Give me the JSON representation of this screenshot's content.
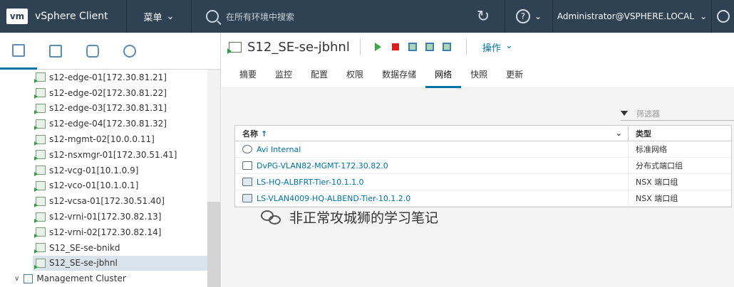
{
  "topbar": {
    "logo": "vm",
    "app_title": "vSphere Client",
    "menu_label": "菜单",
    "search_placeholder": "在所有环境中搜索",
    "user": "Administrator@VSPHERE.LOCAL"
  },
  "left_tabs": [
    {
      "icon": "hosts-clusters-icon"
    },
    {
      "icon": "vms-templates-icon"
    },
    {
      "icon": "storage-icon"
    },
    {
      "icon": "network-icon"
    }
  ],
  "tree": [
    {
      "label": "s12-edge-01[172.30.81.21]"
    },
    {
      "label": "s12-edge-02[172.30.81.22]"
    },
    {
      "label": "s12-edge-03[172.30.81.31]"
    },
    {
      "label": "s12-edge-04[172.30.81.32]"
    },
    {
      "label": "s12-mgmt-02[10.0.0.11]"
    },
    {
      "label": "s12-nsxmgr-01[172.30.51.41]"
    },
    {
      "label": "s12-vcg-01[10.1.0.9]"
    },
    {
      "label": "s12-vco-01[10.1.0.1]"
    },
    {
      "label": "s12-vcsa-01[172.30.51.40]"
    },
    {
      "label": "s12-vrni-01[172.30.82.13]"
    },
    {
      "label": "s12-vrni-02[172.30.82.14]"
    },
    {
      "label": "S12_SE-se-bnikd"
    },
    {
      "label": "S12_SE-se-jbhnl"
    }
  ],
  "cluster": {
    "label": "Management Cluster"
  },
  "object": {
    "title": "S12_SE-se-jbhnl",
    "actions_label": "操作"
  },
  "tabs": [
    "摘要",
    "监控",
    "配置",
    "权限",
    "数据存储",
    "网络",
    "快照",
    "更新"
  ],
  "active_tab": "网络",
  "filter": {
    "placeholder": "筛选器"
  },
  "grid": {
    "columns": [
      "名称",
      "类型"
    ],
    "sort_indicator": "↑",
    "rows": [
      {
        "name": "Avi Internal",
        "type": "标准网络",
        "icon": "standard-network-icon"
      },
      {
        "name": "DvPG-VLAN82-MGMT-172.30.82.0",
        "type": "分布式端口组",
        "icon": "distributed-portgroup-icon"
      },
      {
        "name": "LS-HQ-ALBFRT-Tier-10.1.1.0",
        "type": "NSX 端口组",
        "icon": "nsx-portgroup-icon"
      },
      {
        "name": "LS-VLAN4009-HQ-ALBEND-Tier-10.1.2.0",
        "type": "NSX 端口组",
        "icon": "nsx-portgroup-icon"
      }
    ]
  },
  "watermark": "非正常攻城狮的学习笔记"
}
